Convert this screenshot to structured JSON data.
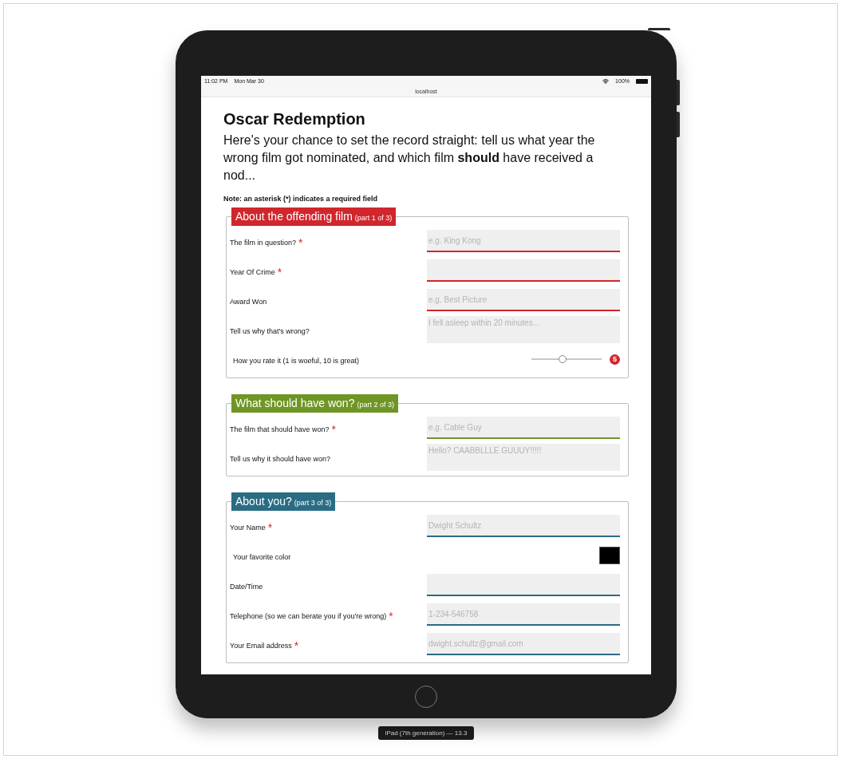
{
  "status_bar": {
    "time": "11:02 PM",
    "date": "Mon Mar 30",
    "battery": "100%"
  },
  "address_bar": {
    "url": "localhost"
  },
  "page": {
    "title": "Oscar Redemption",
    "intro": "Here's your chance to set the record straight: tell us what year the wrong film got nominated, and which film **should** have received a nod...",
    "note": "Note: an asterisk (*) indicates a required field",
    "required_marker": "*"
  },
  "sections": [
    {
      "title": "About the offending film",
      "part": "(part 1 of 3)",
      "color": "#d0262c",
      "fields": [
        {
          "kind": "input",
          "label": "The film in question?",
          "required": true,
          "placeholder": "e.g. King Kong"
        },
        {
          "kind": "input",
          "label": "Year Of Crime",
          "required": true
        },
        {
          "kind": "input",
          "label": "Award Won",
          "required": false,
          "placeholder": "e.g. Best Picture"
        },
        {
          "kind": "textarea",
          "label": "Tell us why that's wrong?",
          "required": false,
          "placeholder": "I fell asleep within 20 minutes..."
        },
        {
          "kind": "slider",
          "label": "How you rate it (1 is woeful, 10 is great)",
          "required": false,
          "level": 0.44,
          "value": "5"
        }
      ]
    },
    {
      "title": "What should have won?",
      "part": "(part 2 of 3)",
      "color": "#6f9624",
      "fields": [
        {
          "kind": "input",
          "label": "The film that should have won?",
          "required": true,
          "placeholder": "e.g. Cable Guy"
        },
        {
          "kind": "textarea",
          "label": "Tell us why it should have won?",
          "required": false,
          "placeholder": "Hello? CAABBLLLE GUUUY!!!!!"
        }
      ]
    },
    {
      "title": "About you?",
      "part": "(part 3 of 3)",
      "color": "#2a6c84",
      "fields": [
        {
          "kind": "input",
          "label": "Your Name",
          "required": true,
          "placeholder": "Dwight Schultz"
        },
        {
          "kind": "color",
          "label": "Your favorite color",
          "required": false,
          "color": "#000000"
        },
        {
          "kind": "input",
          "label": "Date/Time",
          "required": false
        },
        {
          "kind": "input",
          "label": "Telephone (so we can berate you if you're wrong)",
          "required": true,
          "placeholder": "1-234-546758"
        },
        {
          "kind": "input",
          "label": "Your Email address",
          "required": true,
          "placeholder": "dwight.schultz@gmail.com"
        }
      ]
    }
  ],
  "device_label": "iPad (7th generation) — 13.3"
}
